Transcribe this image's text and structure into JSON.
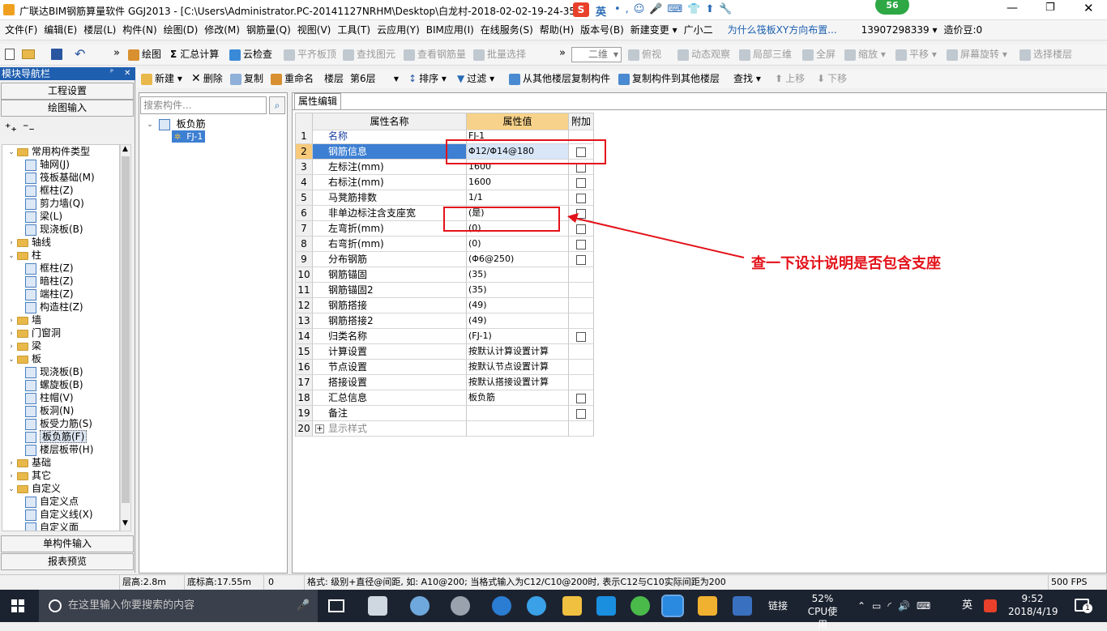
{
  "window": {
    "title": "广联达BIM钢筋算量软件 GGJ2013 - [C:\\Users\\Administrator.PC-20141127NRHM\\Desktop\\白龙村-2018-02-02-19-24-35",
    "ime_label": "英",
    "badge_count": "56"
  },
  "menu": [
    "文件(F)",
    "编辑(E)",
    "楼层(L)",
    "构件(N)",
    "绘图(D)",
    "修改(M)",
    "钢筋量(Q)",
    "视图(V)",
    "工具(T)",
    "云应用(Y)",
    "BIM应用(I)",
    "在线服务(S)",
    "帮助(H)",
    "版本号(B)",
    "新建变更 ▾",
    "广小二",
    "为什么筏板XY方向布置...",
    "13907298339 ▾",
    "造价豆:0"
  ],
  "toolbar1": {
    "draw": "绘图",
    "sum": "汇总计算",
    "cloud_check": "云检查",
    "flat_top": "平齐板顶",
    "find_elem": "查找图元",
    "view_rebar": "查看钢筋量",
    "batch_select": "批量选择",
    "view_mode": "二维",
    "top_view": "俯视",
    "dynamic": "动态观察",
    "local3d": "局部三维",
    "fullscreen": "全屏",
    "zoom": "缩放",
    "pan": "平移",
    "rotate": "屏幕旋转",
    "select_floor": "选择楼层"
  },
  "toolbar2": {
    "new": "新建",
    "delete": "删除",
    "copy": "复制",
    "rename": "重命名",
    "floor_label": "楼层",
    "floor_value": "第6层",
    "sort": "排序",
    "filter": "过滤",
    "copy_from": "从其他楼层复制构件",
    "copy_to": "复制构件到其他楼层",
    "find": "查找",
    "move_up": "上移",
    "move_down": "下移"
  },
  "left_panel": {
    "header": "模块导航栏",
    "pin": "ᴾ",
    "close": "✕",
    "btn_project": "工程设置",
    "btn_draw": "绘图输入",
    "btn_single": "单构件输入",
    "btn_report": "报表预览",
    "tree": [
      {
        "label": "常用构件类型",
        "level": 0,
        "type": "folder",
        "expanded": true
      },
      {
        "label": "轴网(J)",
        "level": 1,
        "type": "item"
      },
      {
        "label": "筏板基础(M)",
        "level": 1,
        "type": "item"
      },
      {
        "label": "框柱(Z)",
        "level": 1,
        "type": "item"
      },
      {
        "label": "剪力墙(Q)",
        "level": 1,
        "type": "item"
      },
      {
        "label": "梁(L)",
        "level": 1,
        "type": "item"
      },
      {
        "label": "现浇板(B)",
        "level": 1,
        "type": "item"
      },
      {
        "label": "轴线",
        "level": 0,
        "type": "folder",
        "expanded": false
      },
      {
        "label": "柱",
        "level": 0,
        "type": "folder",
        "expanded": true
      },
      {
        "label": "框柱(Z)",
        "level": 1,
        "type": "item"
      },
      {
        "label": "暗柱(Z)",
        "level": 1,
        "type": "item"
      },
      {
        "label": "端柱(Z)",
        "level": 1,
        "type": "item"
      },
      {
        "label": "构造柱(Z)",
        "level": 1,
        "type": "item"
      },
      {
        "label": "墙",
        "level": 0,
        "type": "folder",
        "expanded": false
      },
      {
        "label": "门窗洞",
        "level": 0,
        "type": "folder",
        "expanded": false
      },
      {
        "label": "梁",
        "level": 0,
        "type": "folder",
        "expanded": false
      },
      {
        "label": "板",
        "level": 0,
        "type": "folder",
        "expanded": true
      },
      {
        "label": "现浇板(B)",
        "level": 1,
        "type": "item"
      },
      {
        "label": "螺旋板(B)",
        "level": 1,
        "type": "item"
      },
      {
        "label": "柱帽(V)",
        "level": 1,
        "type": "item"
      },
      {
        "label": "板洞(N)",
        "level": 1,
        "type": "item"
      },
      {
        "label": "板受力筋(S)",
        "level": 1,
        "type": "item"
      },
      {
        "label": "板负筋(F)",
        "level": 1,
        "type": "item",
        "selected": true
      },
      {
        "label": "楼层板带(H)",
        "level": 1,
        "type": "item"
      },
      {
        "label": "基础",
        "level": 0,
        "type": "folder",
        "expanded": false
      },
      {
        "label": "其它",
        "level": 0,
        "type": "folder",
        "expanded": false
      },
      {
        "label": "自定义",
        "level": 0,
        "type": "folder",
        "expanded": true
      },
      {
        "label": "自定义点",
        "level": 1,
        "type": "item"
      },
      {
        "label": "自定义线(X)",
        "level": 1,
        "type": "item"
      },
      {
        "label": "自定义面",
        "level": 1,
        "type": "item"
      }
    ]
  },
  "mid_panel": {
    "search_placeholder": "搜索构件...",
    "root": "板负筋",
    "child": "FJ-1"
  },
  "prop_editor": {
    "tab": "属性编辑",
    "col_name": "属性名称",
    "col_value": "属性值",
    "col_extra": "附加",
    "rows": [
      {
        "n": "1",
        "name": "名称",
        "value": "FJ-1",
        "cb": false
      },
      {
        "n": "2",
        "name": "钢筋信息",
        "value": "Φ12/Φ14@180",
        "cb": true
      },
      {
        "n": "3",
        "name": "左标注(mm)",
        "value": "1600",
        "cb": true
      },
      {
        "n": "4",
        "name": "右标注(mm)",
        "value": "1600",
        "cb": true
      },
      {
        "n": "5",
        "name": "马凳筋排数",
        "value": "1/1",
        "cb": true
      },
      {
        "n": "6",
        "name": "非单边标注含支座宽",
        "value": "(是)",
        "cb": true
      },
      {
        "n": "7",
        "name": "左弯折(mm)",
        "value": "(0)",
        "cb": true
      },
      {
        "n": "8",
        "name": "右弯折(mm)",
        "value": "(0)",
        "cb": true
      },
      {
        "n": "9",
        "name": "分布钢筋",
        "value": "(Φ6@250)",
        "cb": true
      },
      {
        "n": "10",
        "name": "钢筋锚固",
        "value": "(35)",
        "cb": false
      },
      {
        "n": "11",
        "name": "钢筋锚固2",
        "value": "(35)",
        "cb": false
      },
      {
        "n": "12",
        "name": "钢筋搭接",
        "value": "(49)",
        "cb": false
      },
      {
        "n": "13",
        "name": "钢筋搭接2",
        "value": "(49)",
        "cb": false
      },
      {
        "n": "14",
        "name": "归类名称",
        "value": "(FJ-1)",
        "cb": true
      },
      {
        "n": "15",
        "name": "计算设置",
        "value": "按默认计算设置计算",
        "cb": false
      },
      {
        "n": "16",
        "name": "节点设置",
        "value": "按默认节点设置计算",
        "cb": false
      },
      {
        "n": "17",
        "name": "搭接设置",
        "value": "按默认搭接设置计算",
        "cb": false
      },
      {
        "n": "18",
        "name": "汇总信息",
        "value": "板负筋",
        "cb": true
      },
      {
        "n": "19",
        "name": "备注",
        "value": "",
        "cb": true
      },
      {
        "n": "20",
        "name": "显示样式",
        "value": "",
        "cb": false,
        "expandable": true
      }
    ]
  },
  "annotation": "查一下设计说明是否包含支座",
  "status": {
    "floor_height": "层高:2.8m",
    "base_height": "底标高:17.55m",
    "zero": "0",
    "hint": "格式: 级别+直径@间距, 如: A10@200; 当格式输入为C12/C10@200时, 表示C12与C10实际间距为200",
    "fps": "500 FPS"
  },
  "taskbar": {
    "search_placeholder": "在这里输入你要搜索的内容",
    "link": "链接",
    "cpu_percent": "52%",
    "cpu_label": "CPU使用",
    "lang": "英",
    "time": "9:52",
    "date": "2018/4/19",
    "notif": "1"
  },
  "colors": {
    "accent_blue": "#1f5fb0",
    "selection": "#3d7fd2",
    "header_value": "#f7d28a",
    "annotation_red": "#e3121a",
    "taskbar": "#1c2330"
  }
}
